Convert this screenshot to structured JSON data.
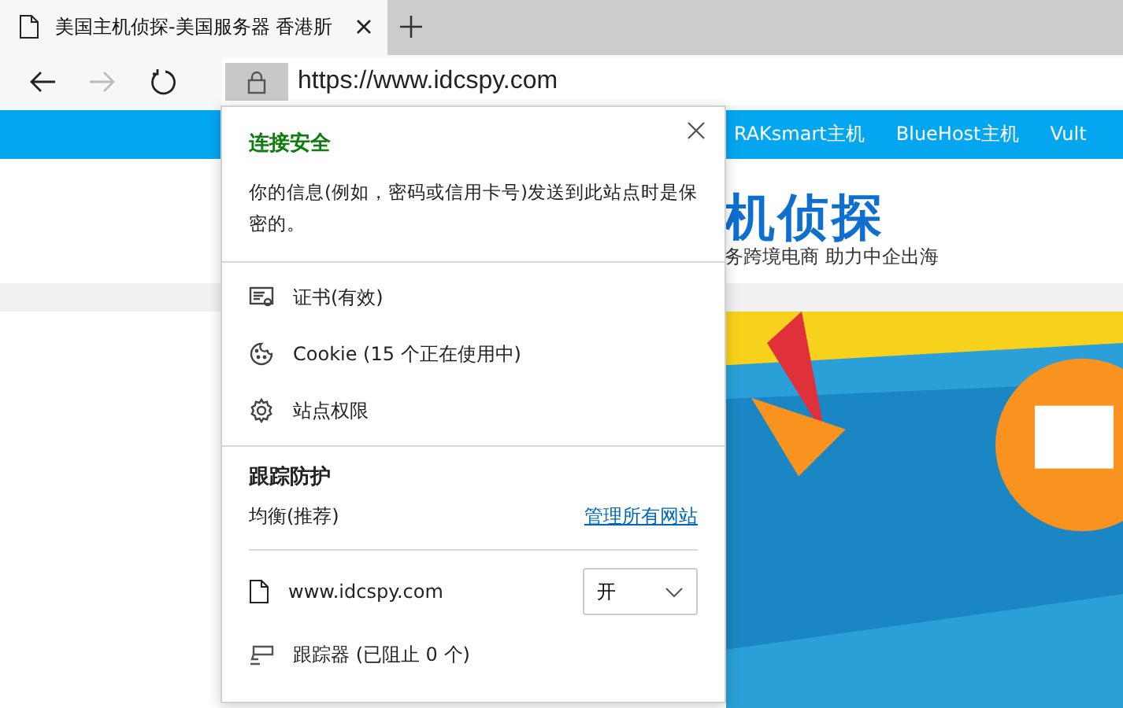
{
  "tabs": [
    {
      "title": "美国主机侦探-美国服务器 香港肵",
      "selected": true
    }
  ],
  "address_bar": {
    "url": "https://www.idcspy.com"
  },
  "site": {
    "nav_items": [
      "RAKsmart主机",
      "BlueHost主机",
      "Vult"
    ],
    "logo_text": "机侦探",
    "slogan": "务跨境电商 助力中企出海"
  },
  "site_info_popup": {
    "title": "连接安全",
    "description": "你的信息(例如，密码或信用卡号)发送到此站点时是保密的。",
    "items": [
      {
        "kind": "certificate",
        "label": "证书(有效)"
      },
      {
        "kind": "cookie",
        "label": "Cookie (15 个正在使用中)"
      },
      {
        "kind": "permissions",
        "label": "站点权限"
      }
    ],
    "tracking": {
      "title": "跟踪防护",
      "level_label": "均衡(推荐)",
      "manage_link": "管理所有网站",
      "site": "www.idcspy.com",
      "toggle_value": "开",
      "trackers": "跟踪器 (已阻止 0 个)"
    }
  }
}
